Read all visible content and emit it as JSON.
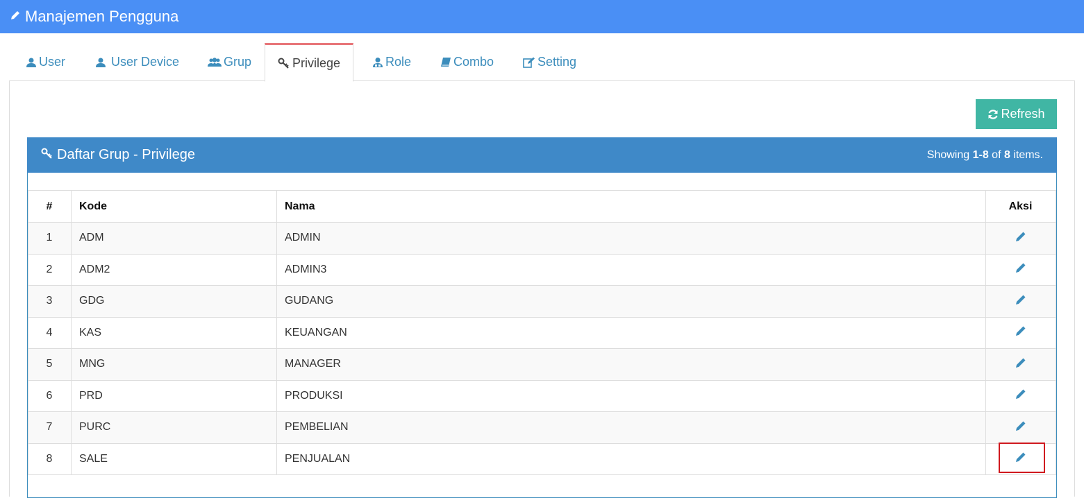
{
  "header": {
    "title": "Manajemen Pengguna",
    "icon": "pencil-icon"
  },
  "tabs": [
    {
      "label": "User",
      "icon": "user-icon"
    },
    {
      "label": "User Device",
      "icon": "user-icon"
    },
    {
      "label": "Grup",
      "icon": "users-icon"
    },
    {
      "label": "Privilege",
      "icon": "key-icon",
      "active": true
    },
    {
      "label": "Role",
      "icon": "role-icon"
    },
    {
      "label": "Combo",
      "icon": "book-icon"
    },
    {
      "label": "Setting",
      "icon": "edit-icon"
    }
  ],
  "toolbar": {
    "refresh_label": "Refresh"
  },
  "panel": {
    "title": "Daftar Grup - Privilege",
    "summary_prefix": "Showing ",
    "summary_range": "1-8",
    "summary_of": " of ",
    "summary_total": "8",
    "summary_suffix": " items."
  },
  "table": {
    "headers": [
      "#",
      "Kode",
      "Nama",
      "Aksi"
    ],
    "rows": [
      {
        "no": "1",
        "kode": "ADM",
        "nama": "ADMIN"
      },
      {
        "no": "2",
        "kode": "ADM2",
        "nama": "ADMIN3"
      },
      {
        "no": "3",
        "kode": "GDG",
        "nama": "GUDANG"
      },
      {
        "no": "4",
        "kode": "KAS",
        "nama": "KEUANGAN"
      },
      {
        "no": "5",
        "kode": "MNG",
        "nama": "MANAGER"
      },
      {
        "no": "6",
        "kode": "PRD",
        "nama": "PRODUKSI"
      },
      {
        "no": "7",
        "kode": "PURC",
        "nama": "PEMBELIAN"
      },
      {
        "no": "8",
        "kode": "SALE",
        "nama": "PENJUALAN"
      }
    ]
  },
  "colors": {
    "topbar": "#4a8ff5",
    "panel_header": "#3f89c8",
    "refresh_button": "#40b6a4",
    "link": "#3c8dbc",
    "active_tab_border": "#e8767a",
    "highlight": "#d0191f"
  }
}
